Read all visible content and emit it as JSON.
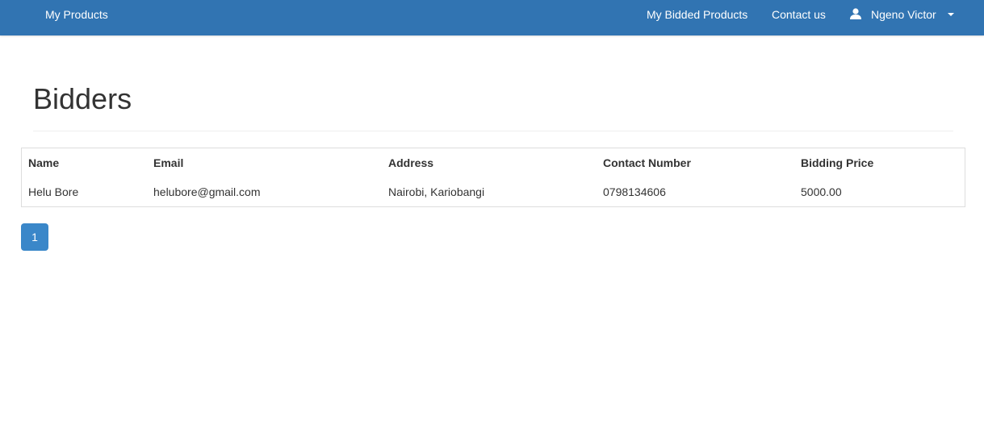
{
  "navbar": {
    "brand": "My Products",
    "links": {
      "bidded": "My Bidded Products",
      "contact": "Contact us"
    },
    "user": {
      "icon": "user-icon",
      "name": "Ngeno Victor"
    },
    "background": "#3174b2"
  },
  "page": {
    "title": "Bidders"
  },
  "table": {
    "headers": [
      "Name",
      "Email",
      "Address",
      "Contact Number",
      "Bidding Price"
    ],
    "rows": [
      [
        "Helu Bore",
        "helubore@gmail.com",
        "Nairobi, Kariobangi",
        "0798134606",
        "5000.00"
      ]
    ]
  },
  "pagination": {
    "current": "1",
    "accent": "#3a87c9"
  }
}
